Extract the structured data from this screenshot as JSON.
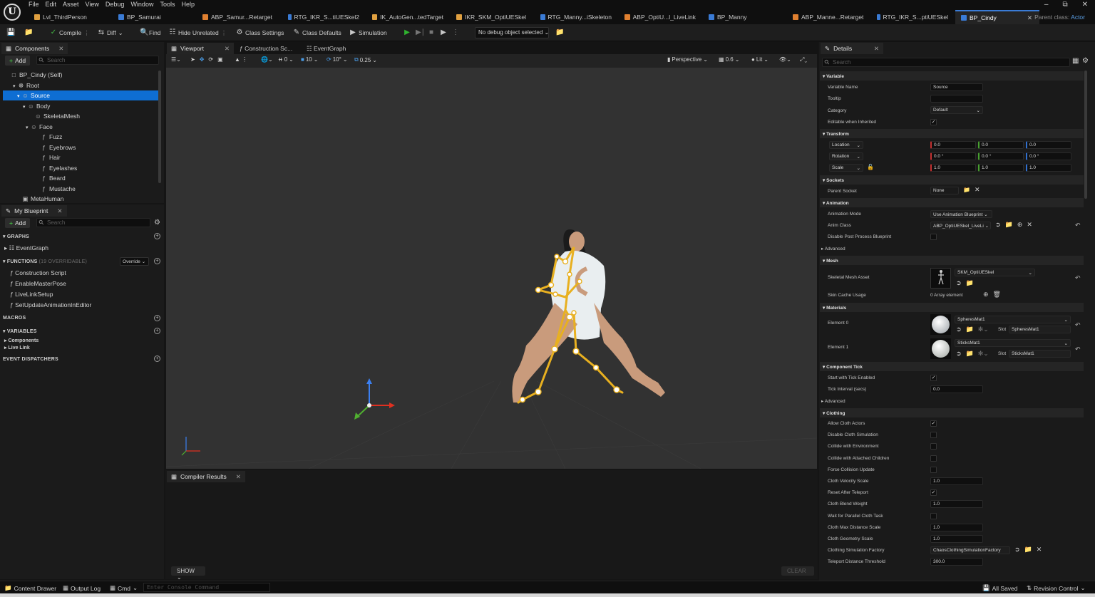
{
  "app": {
    "logo": "U"
  },
  "menu": [
    "File",
    "Edit",
    "Asset",
    "View",
    "Debug",
    "Window",
    "Tools",
    "Help"
  ],
  "tabs": [
    {
      "label": "Lvl_ThirdPerson",
      "color": "#e0a040"
    },
    {
      "label": "BP_Samurai",
      "color": "#3a7bd5"
    },
    {
      "label": "ABP_Samur...Retarget",
      "color": "#e08030"
    },
    {
      "label": "RTG_IKR_S...tiUESkel2",
      "color": "#3a7bd5"
    },
    {
      "label": "IK_AutoGen...tedTarget",
      "color": "#e0a040"
    },
    {
      "label": "IKR_SKM_OptiUESkel",
      "color": "#e0a040"
    },
    {
      "label": "RTG_Manny...iSkeleton",
      "color": "#3a7bd5"
    },
    {
      "label": "ABP_OptiU...l_LiveLink",
      "color": "#e08030"
    },
    {
      "label": "BP_Manny",
      "color": "#3a7bd5"
    },
    {
      "label": "ABP_Manne...Retarget",
      "color": "#e08030"
    },
    {
      "label": "RTG_IKR_S...ptiUESkel",
      "color": "#3a7bd5"
    },
    {
      "label": "BP_Cindy",
      "color": "#3a7bd5"
    }
  ],
  "parent_class": {
    "label": "Parent class:",
    "value": "Actor"
  },
  "toolbar": {
    "compile": "Compile",
    "diff": "Diff",
    "find": "Find",
    "hide_unrelated": "Hide Unrelated",
    "class_settings": "Class Settings",
    "class_defaults": "Class Defaults",
    "simulation": "Simulation",
    "debug_object": "No debug object selected"
  },
  "components": {
    "tab": "Components",
    "add": "Add",
    "search_placeholder": "Search",
    "items": [
      {
        "label": "BP_Cindy (Self)"
      },
      {
        "label": "Root"
      },
      {
        "label": "Source"
      },
      {
        "label": "Body"
      },
      {
        "label": "SkeletalMesh"
      },
      {
        "label": "Face"
      },
      {
        "label": "Fuzz"
      },
      {
        "label": "Eyebrows"
      },
      {
        "label": "Hair"
      },
      {
        "label": "Eyelashes"
      },
      {
        "label": "Beard"
      },
      {
        "label": "Mustache"
      },
      {
        "label": "MetaHuman"
      }
    ]
  },
  "myblueprint": {
    "tab": "My Blueprint",
    "add": "Add",
    "search_placeholder": "Search",
    "graphs": "GRAPHS",
    "event_graph": "EventGraph",
    "functions": "FUNCTIONS",
    "functions_count": "(19 OVERRIDABLE)",
    "override": "Override",
    "function_items": [
      "Construction Script",
      "EnableMasterPose",
      "LiveLinkSetup",
      "SetUpdateAnimationInEditor"
    ],
    "macros": "MACROS",
    "variables": "VARIABLES",
    "var_items": [
      "Components",
      "Live Link"
    ],
    "dispatchers": "EVENT DISPATCHERS"
  },
  "center_tabs": [
    "Viewport",
    "Construction Sc...",
    "EventGraph"
  ],
  "viewport_toolbar": {
    "snap_angle": "10°",
    "grid": "10",
    "scale": "0.25",
    "perspective": "Perspective",
    "fov": "0.6",
    "lit": "Lit",
    "zero": "0"
  },
  "compiler": {
    "tab": "Compiler Results",
    "show": "SHOW",
    "clear": "CLEAR"
  },
  "details": {
    "tab": "Details",
    "search_placeholder": "Search",
    "sections": {
      "variable": "Variable",
      "transform": "Transform",
      "sockets": "Sockets",
      "animation": "Animation",
      "mesh": "Mesh",
      "materials": "Materials",
      "component_tick": "Component Tick",
      "clothing": "Clothing",
      "advanced": "Advanced"
    },
    "variable_name": {
      "label": "Variable Name",
      "value": "Source"
    },
    "tooltip": {
      "label": "Tooltip",
      "value": ""
    },
    "category": {
      "label": "Category",
      "value": "Default"
    },
    "editable_inherited": "Editable when Inherited",
    "location": {
      "label": "Location",
      "x": "0.0",
      "y": "0.0",
      "z": "0.0"
    },
    "rotation": {
      "label": "Rotation",
      "x": "0.0 °",
      "y": "0.0 °",
      "z": "0.0 °"
    },
    "scale": {
      "label": "Scale",
      "x": "1.0",
      "y": "1.0",
      "z": "1.0"
    },
    "parent_socket": {
      "label": "Parent Socket",
      "value": "None"
    },
    "anim_mode": {
      "label": "Animation Mode",
      "value": "Use Animation Blueprint"
    },
    "anim_class": {
      "label": "Anim Class",
      "value": "ABP_OptiUESkel_LiveLi"
    },
    "disable_post": "Disable Post Process Blueprint",
    "skel_mesh": {
      "label": "Skeletal Mesh Asset",
      "value": "SKM_OptiUESkel"
    },
    "skin_cache": {
      "label": "Skin Cache Usage",
      "value": "0 Array element"
    },
    "element0": {
      "label": "Element 0",
      "value": "SpheresMat1",
      "slot_label": "Slot",
      "slot": "SpheresMat1"
    },
    "element1": {
      "label": "Element 1",
      "value": "SticksMat1",
      "slot_label": "Slot",
      "slot": "SticksMat1"
    },
    "start_tick": "Start with Tick Enabled",
    "tick_interval": {
      "label": "Tick Interval (secs)",
      "value": "0.0"
    },
    "clothing_rows": [
      {
        "label": "Allow Cloth Actors",
        "type": "check",
        "value": "✓"
      },
      {
        "label": "Disable Cloth Simulation",
        "type": "check",
        "value": ""
      },
      {
        "label": "Collide with Environment",
        "type": "check",
        "value": ""
      },
      {
        "label": "Collide with Attached Children",
        "type": "check",
        "value": ""
      },
      {
        "label": "Force Collision Update",
        "type": "check",
        "value": ""
      },
      {
        "label": "Cloth Velocity Scale",
        "type": "num",
        "value": "1.0"
      },
      {
        "label": "Reset After Teleport",
        "type": "check",
        "value": "✓"
      },
      {
        "label": "Cloth Blend Weight",
        "type": "num",
        "value": "1.0"
      },
      {
        "label": "Wait for Parallel Cloth Task",
        "type": "check",
        "value": ""
      },
      {
        "label": "Cloth Max Distance Scale",
        "type": "num",
        "value": "1.0"
      },
      {
        "label": "Cloth Geometry Scale",
        "type": "num",
        "value": "1.0"
      },
      {
        "label": "Clothing Simulation Factory",
        "type": "dd",
        "value": "ChaosClothingSimulationFactory"
      },
      {
        "label": "Teleport Distance Threshold",
        "type": "num",
        "value": "300.0"
      }
    ]
  },
  "statusbar": {
    "content_drawer": "Content Drawer",
    "output_log": "Output Log",
    "cmd": "Cmd",
    "console_placeholder": "Enter Console Command",
    "all_saved": "All Saved",
    "revision": "Revision Control"
  }
}
